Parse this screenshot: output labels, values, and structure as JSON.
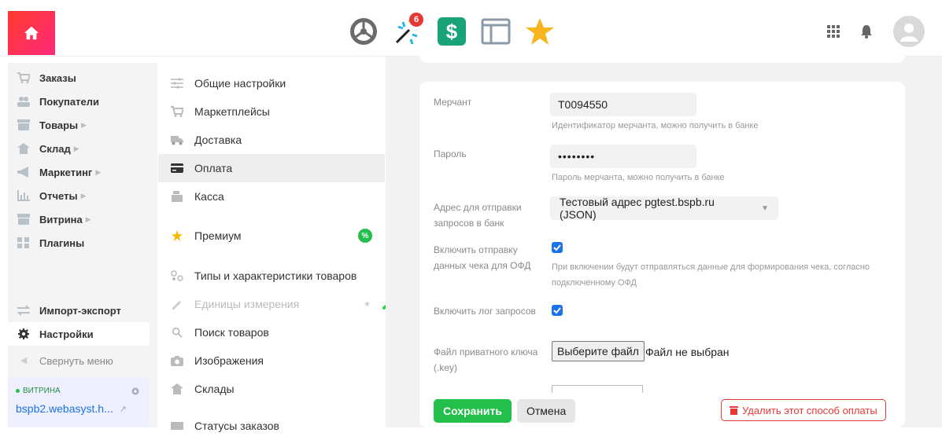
{
  "colors": {
    "accent": "#1a73e8",
    "save": "#22c04a",
    "danger": "#e53935"
  },
  "topbar": {
    "apps": [
      {
        "name": "settings-app",
        "icon": "gear-icon"
      },
      {
        "name": "sparkle-app",
        "icon": "sparkle-icon",
        "badge": "6"
      },
      {
        "name": "dollar-app",
        "icon": "dollar-icon"
      },
      {
        "name": "window-app",
        "icon": "window-icon"
      },
      {
        "name": "star-app",
        "icon": "star-icon"
      }
    ]
  },
  "leftnav": {
    "items": [
      {
        "label": "Заказы"
      },
      {
        "label": "Покупатели"
      },
      {
        "label": "Товары"
      },
      {
        "label": "Склад"
      },
      {
        "label": "Маркетинг"
      },
      {
        "label": "Отчеты"
      },
      {
        "label": "Витрина"
      },
      {
        "label": "Плагины"
      }
    ],
    "import_export": "Импорт-экспорт",
    "settings": "Настройки",
    "collapse": "Свернуть меню",
    "store": {
      "tag": "ВИТРИНА",
      "domain": "bspb2.webasyst.h..."
    }
  },
  "subnav": {
    "items": [
      {
        "label": "Общие настройки"
      },
      {
        "label": "Маркетплейсы"
      },
      {
        "label": "Доставка"
      },
      {
        "label": "Оплата"
      },
      {
        "label": "Касса"
      },
      {
        "label": "Премиум"
      },
      {
        "label": "Типы и характеристики товаров"
      },
      {
        "label": "Единицы измерения"
      },
      {
        "label": "Поиск товаров"
      },
      {
        "label": "Изображения"
      },
      {
        "label": "Склады"
      },
      {
        "label": "Статусы заказов"
      }
    ]
  },
  "form": {
    "merchant_label": "Мерчант",
    "merchant_value": "T0094550",
    "merchant_hint": "Идентификатор мерчанта, можно получить в банке",
    "password_label": "Пароль",
    "password_value": "••••••••",
    "password_hint": "Пароль мерчанта, можно получить в банке",
    "address_label": "Адрес для отправки запросов в банк",
    "address_value": "Тестовый адрес pgtest.bspb.ru (JSON)",
    "ofd_label": "Включить отправку данных чека для ОФД",
    "ofd_hint": "При включении будут отправляться данные для формирования чека, согласно подключенному ОФД",
    "log_label": "Включить лог запросов",
    "key_label": "Файл приватного ключа (.key)",
    "file_button": "Выберите файл",
    "file_status": "Файл не выбран"
  },
  "footer": {
    "save": "Сохранить",
    "cancel": "Отмена",
    "delete": "Удалить этот способ оплаты"
  }
}
